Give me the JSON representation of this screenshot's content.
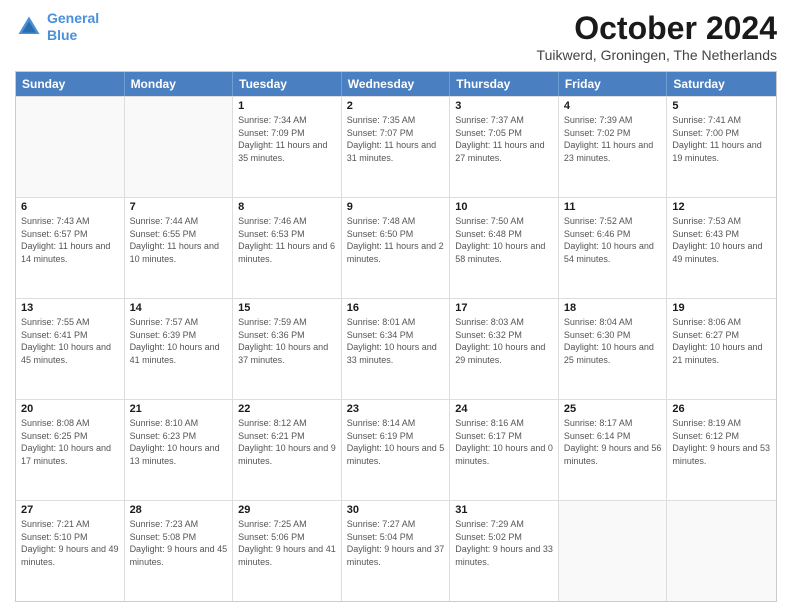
{
  "header": {
    "logo_line1": "General",
    "logo_line2": "Blue",
    "title": "October 2024",
    "subtitle": "Tuikwerd, Groningen, The Netherlands"
  },
  "days_of_week": [
    "Sunday",
    "Monday",
    "Tuesday",
    "Wednesday",
    "Thursday",
    "Friday",
    "Saturday"
  ],
  "weeks": [
    [
      {
        "day": "",
        "sunrise": "",
        "sunset": "",
        "daylight": ""
      },
      {
        "day": "",
        "sunrise": "",
        "sunset": "",
        "daylight": ""
      },
      {
        "day": "1",
        "sunrise": "Sunrise: 7:34 AM",
        "sunset": "Sunset: 7:09 PM",
        "daylight": "Daylight: 11 hours and 35 minutes."
      },
      {
        "day": "2",
        "sunrise": "Sunrise: 7:35 AM",
        "sunset": "Sunset: 7:07 PM",
        "daylight": "Daylight: 11 hours and 31 minutes."
      },
      {
        "day": "3",
        "sunrise": "Sunrise: 7:37 AM",
        "sunset": "Sunset: 7:05 PM",
        "daylight": "Daylight: 11 hours and 27 minutes."
      },
      {
        "day": "4",
        "sunrise": "Sunrise: 7:39 AM",
        "sunset": "Sunset: 7:02 PM",
        "daylight": "Daylight: 11 hours and 23 minutes."
      },
      {
        "day": "5",
        "sunrise": "Sunrise: 7:41 AM",
        "sunset": "Sunset: 7:00 PM",
        "daylight": "Daylight: 11 hours and 19 minutes."
      }
    ],
    [
      {
        "day": "6",
        "sunrise": "Sunrise: 7:43 AM",
        "sunset": "Sunset: 6:57 PM",
        "daylight": "Daylight: 11 hours and 14 minutes."
      },
      {
        "day": "7",
        "sunrise": "Sunrise: 7:44 AM",
        "sunset": "Sunset: 6:55 PM",
        "daylight": "Daylight: 11 hours and 10 minutes."
      },
      {
        "day": "8",
        "sunrise": "Sunrise: 7:46 AM",
        "sunset": "Sunset: 6:53 PM",
        "daylight": "Daylight: 11 hours and 6 minutes."
      },
      {
        "day": "9",
        "sunrise": "Sunrise: 7:48 AM",
        "sunset": "Sunset: 6:50 PM",
        "daylight": "Daylight: 11 hours and 2 minutes."
      },
      {
        "day": "10",
        "sunrise": "Sunrise: 7:50 AM",
        "sunset": "Sunset: 6:48 PM",
        "daylight": "Daylight: 10 hours and 58 minutes."
      },
      {
        "day": "11",
        "sunrise": "Sunrise: 7:52 AM",
        "sunset": "Sunset: 6:46 PM",
        "daylight": "Daylight: 10 hours and 54 minutes."
      },
      {
        "day": "12",
        "sunrise": "Sunrise: 7:53 AM",
        "sunset": "Sunset: 6:43 PM",
        "daylight": "Daylight: 10 hours and 49 minutes."
      }
    ],
    [
      {
        "day": "13",
        "sunrise": "Sunrise: 7:55 AM",
        "sunset": "Sunset: 6:41 PM",
        "daylight": "Daylight: 10 hours and 45 minutes."
      },
      {
        "day": "14",
        "sunrise": "Sunrise: 7:57 AM",
        "sunset": "Sunset: 6:39 PM",
        "daylight": "Daylight: 10 hours and 41 minutes."
      },
      {
        "day": "15",
        "sunrise": "Sunrise: 7:59 AM",
        "sunset": "Sunset: 6:36 PM",
        "daylight": "Daylight: 10 hours and 37 minutes."
      },
      {
        "day": "16",
        "sunrise": "Sunrise: 8:01 AM",
        "sunset": "Sunset: 6:34 PM",
        "daylight": "Daylight: 10 hours and 33 minutes."
      },
      {
        "day": "17",
        "sunrise": "Sunrise: 8:03 AM",
        "sunset": "Sunset: 6:32 PM",
        "daylight": "Daylight: 10 hours and 29 minutes."
      },
      {
        "day": "18",
        "sunrise": "Sunrise: 8:04 AM",
        "sunset": "Sunset: 6:30 PM",
        "daylight": "Daylight: 10 hours and 25 minutes."
      },
      {
        "day": "19",
        "sunrise": "Sunrise: 8:06 AM",
        "sunset": "Sunset: 6:27 PM",
        "daylight": "Daylight: 10 hours and 21 minutes."
      }
    ],
    [
      {
        "day": "20",
        "sunrise": "Sunrise: 8:08 AM",
        "sunset": "Sunset: 6:25 PM",
        "daylight": "Daylight: 10 hours and 17 minutes."
      },
      {
        "day": "21",
        "sunrise": "Sunrise: 8:10 AM",
        "sunset": "Sunset: 6:23 PM",
        "daylight": "Daylight: 10 hours and 13 minutes."
      },
      {
        "day": "22",
        "sunrise": "Sunrise: 8:12 AM",
        "sunset": "Sunset: 6:21 PM",
        "daylight": "Daylight: 10 hours and 9 minutes."
      },
      {
        "day": "23",
        "sunrise": "Sunrise: 8:14 AM",
        "sunset": "Sunset: 6:19 PM",
        "daylight": "Daylight: 10 hours and 5 minutes."
      },
      {
        "day": "24",
        "sunrise": "Sunrise: 8:16 AM",
        "sunset": "Sunset: 6:17 PM",
        "daylight": "Daylight: 10 hours and 0 minutes."
      },
      {
        "day": "25",
        "sunrise": "Sunrise: 8:17 AM",
        "sunset": "Sunset: 6:14 PM",
        "daylight": "Daylight: 9 hours and 56 minutes."
      },
      {
        "day": "26",
        "sunrise": "Sunrise: 8:19 AM",
        "sunset": "Sunset: 6:12 PM",
        "daylight": "Daylight: 9 hours and 53 minutes."
      }
    ],
    [
      {
        "day": "27",
        "sunrise": "Sunrise: 7:21 AM",
        "sunset": "Sunset: 5:10 PM",
        "daylight": "Daylight: 9 hours and 49 minutes."
      },
      {
        "day": "28",
        "sunrise": "Sunrise: 7:23 AM",
        "sunset": "Sunset: 5:08 PM",
        "daylight": "Daylight: 9 hours and 45 minutes."
      },
      {
        "day": "29",
        "sunrise": "Sunrise: 7:25 AM",
        "sunset": "Sunset: 5:06 PM",
        "daylight": "Daylight: 9 hours and 41 minutes."
      },
      {
        "day": "30",
        "sunrise": "Sunrise: 7:27 AM",
        "sunset": "Sunset: 5:04 PM",
        "daylight": "Daylight: 9 hours and 37 minutes."
      },
      {
        "day": "31",
        "sunrise": "Sunrise: 7:29 AM",
        "sunset": "Sunset: 5:02 PM",
        "daylight": "Daylight: 9 hours and 33 minutes."
      },
      {
        "day": "",
        "sunrise": "",
        "sunset": "",
        "daylight": ""
      },
      {
        "day": "",
        "sunrise": "",
        "sunset": "",
        "daylight": ""
      }
    ]
  ]
}
